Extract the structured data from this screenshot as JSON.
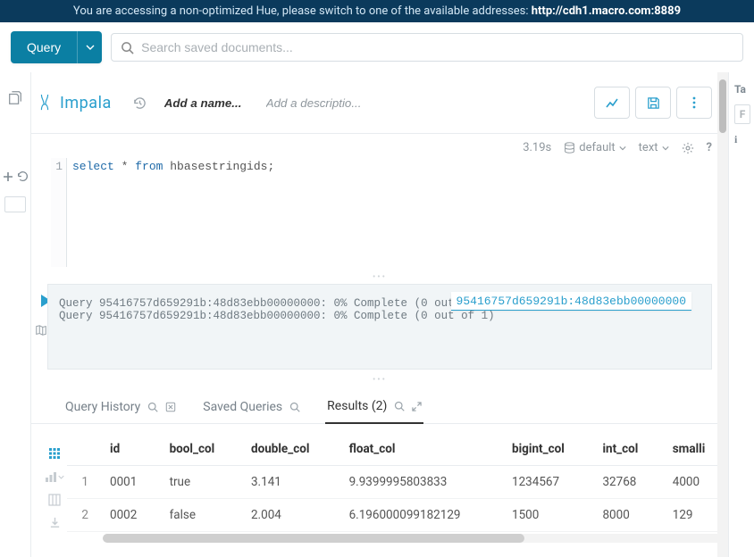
{
  "banner": {
    "text_pre": "You are accessing a non-optimized Hue, please switch to one of the available addresses: ",
    "url": "http://cdh1.macro.com:8889"
  },
  "topbar": {
    "query_label": "Query",
    "search_placeholder": "Search saved documents..."
  },
  "header": {
    "engine": "Impala",
    "name_placeholder": "Add a name...",
    "desc_placeholder": "Add a descriptio..."
  },
  "status": {
    "elapsed": "3.19s",
    "database": "default",
    "format": "text"
  },
  "editor": {
    "line_no": "1",
    "sql_kw1": "select",
    "sql_rest1": " * ",
    "sql_kw2": "from",
    "sql_rest2": " hbasestringids;"
  },
  "log": {
    "line1": "Query 95416757d659291b:48d83ebb00000000: 0% Complete (0 out of 1)",
    "line2": "Query 95416757d659291b:48d83ebb00000000: 0% Complete (0 out of 1)",
    "tooltip": "95416757d659291b:48d83ebb00000000"
  },
  "tabs": {
    "history": "Query History",
    "saved": "Saved Queries",
    "results": "Results (2)"
  },
  "table": {
    "cols": [
      "",
      "id",
      "bool_col",
      "double_col",
      "float_col",
      "bigint_col",
      "int_col",
      "smalli"
    ],
    "rows": [
      {
        "n": "1",
        "id": "0001",
        "bool_col": "true",
        "double_col": "3.141",
        "float_col": "9.9399995803833",
        "bigint_col": "1234567",
        "int_col": "32768",
        "smalli": "4000"
      },
      {
        "n": "2",
        "id": "0002",
        "bool_col": "false",
        "double_col": "2.004",
        "float_col": "6.196000099182129",
        "bigint_col": "1500",
        "int_col": "8000",
        "smalli": "129"
      }
    ]
  },
  "right_rail": {
    "label": "Ta",
    "placeholder": "F"
  }
}
